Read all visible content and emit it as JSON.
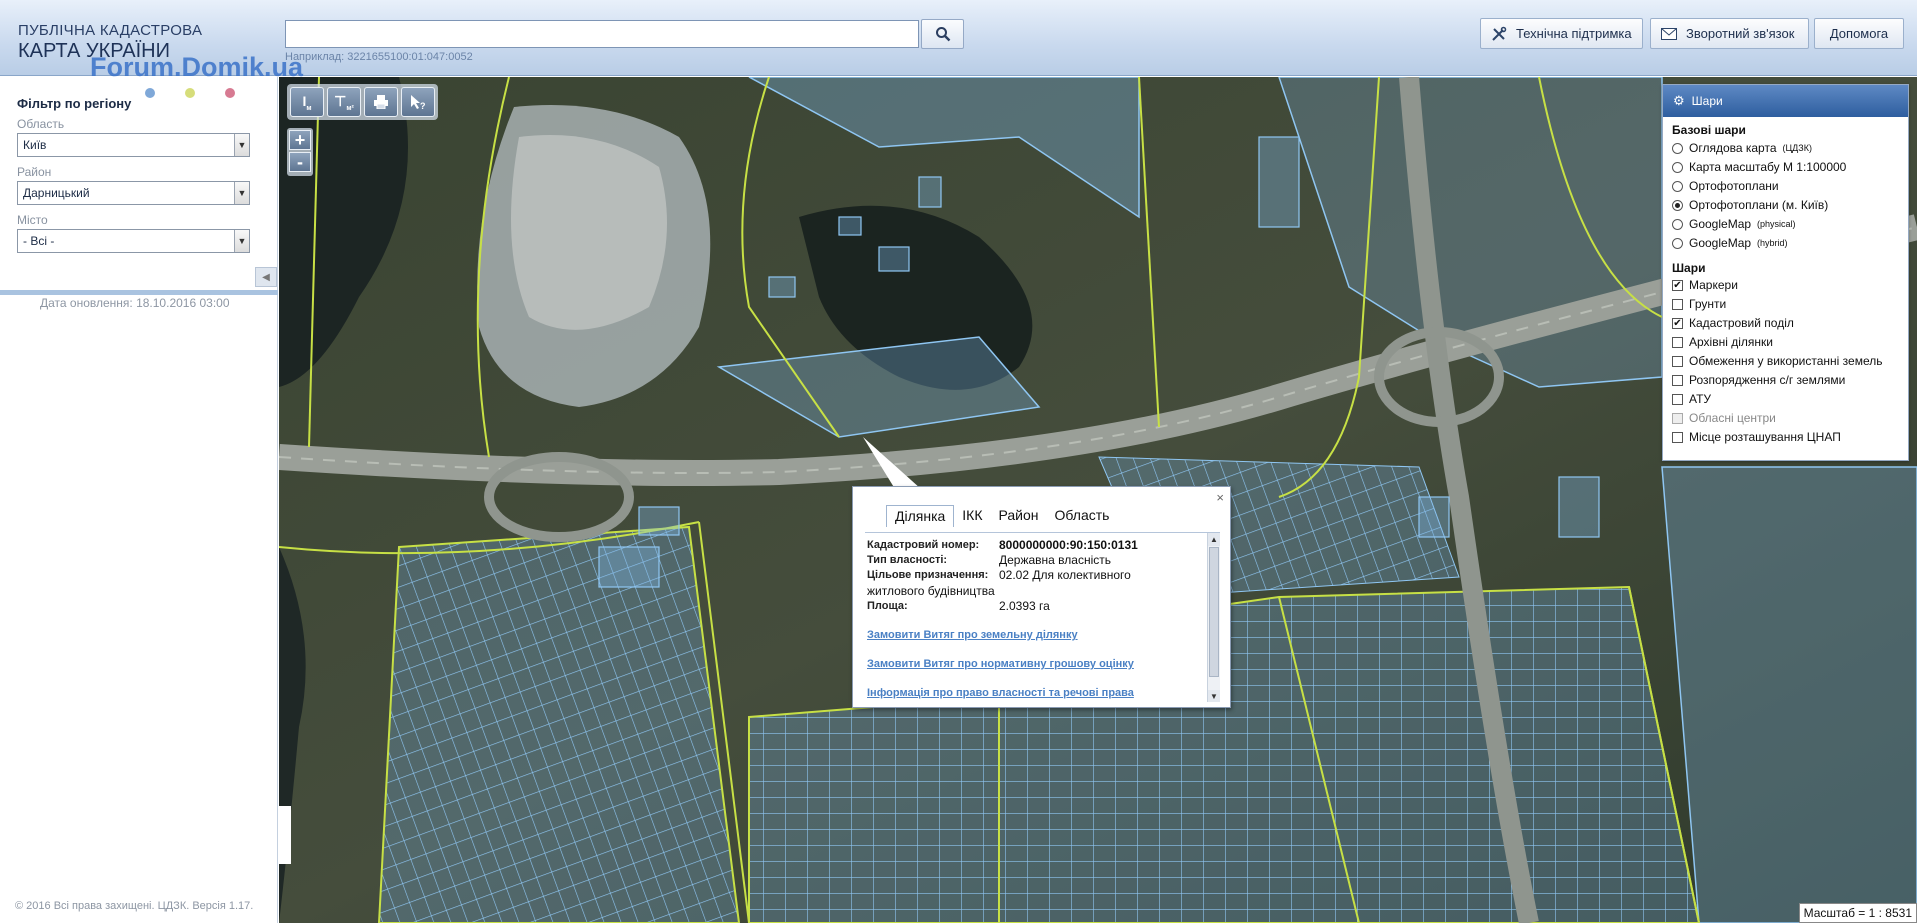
{
  "header": {
    "logo_line1": "ПУБЛІЧНА КАДАСТРОВА",
    "logo_line2": "КАРТА УКРАЇНИ",
    "watermark": "Forum.Domik.ua",
    "search_value": "",
    "search_hint": "Наприклад: 3221655100:01:047:0052",
    "buttons": {
      "support": "Технічна підтримка",
      "feedback": "Зворотний зв'язок",
      "help": "Допомога"
    }
  },
  "sidebar": {
    "title": "Фільтр по регіону",
    "dot_colors": [
      "#7fa8d8",
      "#d6dd7a",
      "#d77a92"
    ],
    "oblast_label": "Область",
    "oblast_value": "Київ",
    "raion_label": "Район",
    "raion_value": "Дарницький",
    "misto_label": "Місто",
    "misto_value": "- Всі -",
    "update_date": "Дата оновлення: 18.10.2016 03:00",
    "copyright": "© 2016 Всі права захищені. ЦДЗК. Версія 1.17."
  },
  "layers": {
    "title": "Шари",
    "base_title": "Базові шари",
    "base": [
      {
        "label": "Оглядова карта",
        "sup": "(ЦДЗК)",
        "checked": false
      },
      {
        "label": "Карта масштабу М 1:100000",
        "sup": "",
        "checked": false
      },
      {
        "label": "Ортофотоплани",
        "sup": "",
        "checked": false
      },
      {
        "label": "Ортофотоплани (м. Київ)",
        "sup": "",
        "checked": true
      },
      {
        "label": "GoogleMap",
        "sup": "(physical)",
        "checked": false
      },
      {
        "label": "GoogleMap",
        "sup": "(hybrid)",
        "checked": false
      }
    ],
    "overlay_title": "Шари",
    "overlays": [
      {
        "label": "Маркери",
        "checked": true,
        "disabled": false
      },
      {
        "label": "Грунти",
        "checked": false,
        "disabled": false
      },
      {
        "label": "Кадастровий поділ",
        "checked": true,
        "disabled": false
      },
      {
        "label": "Архівні ділянки",
        "checked": false,
        "disabled": false
      },
      {
        "label": "Обмеження у використанні земель",
        "checked": false,
        "disabled": false
      },
      {
        "label": "Розпорядження с/г землями",
        "checked": false,
        "disabled": false
      },
      {
        "label": "АТУ",
        "checked": false,
        "disabled": false
      },
      {
        "label": "Обласні центри",
        "checked": false,
        "disabled": true
      },
      {
        "label": "Місце розташування ЦНАП",
        "checked": false,
        "disabled": false
      }
    ]
  },
  "popup": {
    "close": "×",
    "tabs": [
      "Ділянка",
      "ІКК",
      "Район",
      "Область"
    ],
    "fields": [
      {
        "key": "Кадастровий номер:",
        "value": "8000000000:90:150:0131"
      },
      {
        "key": "Тип власності:",
        "value": "Державна власність"
      },
      {
        "key": "Цільове призначення:",
        "value": "02.02 Для колективного"
      },
      {
        "key": "",
        "value": "житлового будівництва"
      },
      {
        "key": "Площа:",
        "value": "2.0393 га"
      }
    ],
    "links": [
      "Замовити Витяг про земельну ділянку",
      "Замовити Витяг про нормативну грошову оцінку",
      "Інформація про право власності та речові права"
    ]
  },
  "map": {
    "scale": "Масштаб = 1 : 8531",
    "tools": [
      "I м",
      "I м²",
      "print",
      "info"
    ],
    "zoom_in": "+",
    "zoom_out": "-"
  }
}
